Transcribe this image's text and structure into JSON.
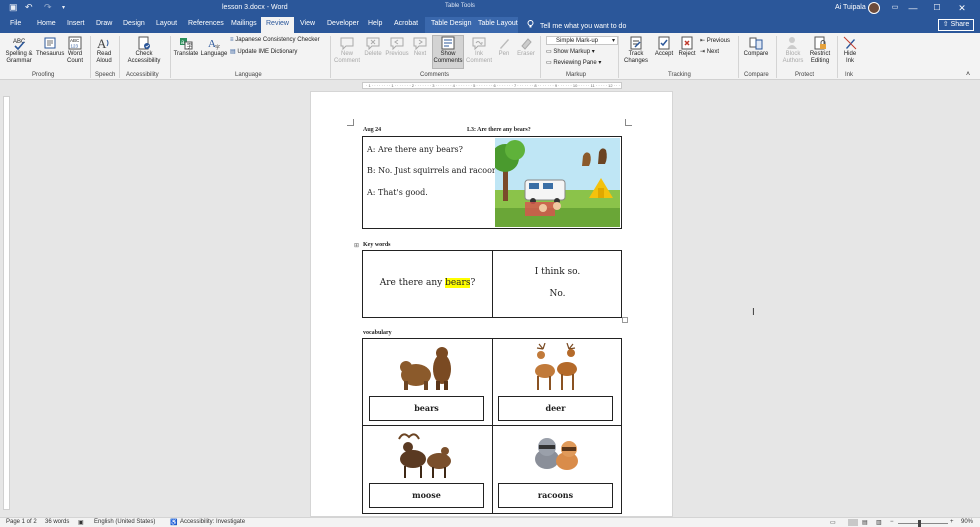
{
  "titlebar": {
    "title": "lesson 3.docx  -  Word",
    "table_tools": "Table Tools",
    "user": "Ai Tuipala",
    "undo_glyph": "↶",
    "redo_glyph": "↷",
    "save_glyph": "▣",
    "minimize": "—",
    "restore": "▭",
    "maximize": "☐",
    "close": "✕"
  },
  "tabs": [
    "File",
    "Home",
    "Insert",
    "Draw",
    "Design",
    "Layout",
    "References",
    "Mailings",
    "Review",
    "View",
    "Developer",
    "Help",
    "Acrobat",
    "Table Design",
    "Table Layout"
  ],
  "tell_me": "Tell me what you want to do",
  "share": "Share",
  "ribbon": {
    "spelling": "Spelling &\nGrammar",
    "thesaurus": "Thesaurus",
    "word_count": "Word\nCount",
    "read_aloud": "Read\nAloud",
    "check_access": "Check\nAccessibility",
    "translate": "Translate",
    "language": "Language",
    "jp_checker": "Japanese Consistency Checker",
    "ime_dict": "Update IME Dictionary",
    "new_comment": "New\nComment",
    "delete": "Delete",
    "previous": "Previous",
    "next": "Next",
    "show_comments": "Show\nComments",
    "ink_comment": "Ink\nComment",
    "pen": "Pen",
    "eraser": "Eraser",
    "markup_mode": "Simple Mark-up",
    "show_markup": "Show Markup",
    "reviewing_pane": "Reviewing Pane",
    "track_changes": "Track\nChanges",
    "accept": "Accept",
    "reject": "Reject",
    "prev_change": "Previous",
    "next_change": "Next",
    "compare": "Compare",
    "block_authors": "Block\nAuthors",
    "restrict": "Restrict\nEditing",
    "hide_ink": "Hide\nInk",
    "groups": {
      "proofing": "Proofing",
      "speech": "Speech",
      "accessibility": "Accessibility",
      "language": "Language",
      "comments": "Comments",
      "markup": "Markup",
      "tracking": "Tracking",
      "compare": "Compare",
      "protect": "Protect",
      "ink": "Ink"
    }
  },
  "ruler": "· 1 · · · · · · · · 1 · · · · · · · 2 · · · · · · · 3 · · · · · · · 4 · · · · · · · 5 · · · · · · · 6 · · · · · · · 7 · · · · · · · 8 · · · · · · · 9 · · · · · · 10 · · · · · 11 · · · · · 12 · · · · · 13 · · · · · 14 · · · · · 15 · · · · 16 · · · · 17 · · · · 18",
  "document": {
    "date": "Aug 24",
    "lesson": "L3: Are there any bears?",
    "dialogue": [
      "A: Are there any bears?",
      "B: No. Just squirrels and racoons.",
      "A: That's good."
    ],
    "key_words_heading": "Key words",
    "question_before": "Are there any ",
    "question_highlight": "bears",
    "question_after": "?",
    "answer1": "I think so.",
    "answer2": "No.",
    "vocab_heading": "vocabulary",
    "vocab": [
      "bears",
      "deer",
      "moose",
      "racoons"
    ]
  },
  "statusbar": {
    "page": "Page 1 of 2",
    "words": "36 words",
    "language": "English (United States)",
    "accessibility": "Accessibility: Investigate",
    "zoom": "90%"
  },
  "colors": {
    "accent": "#2b579a",
    "highlight": "#ffff00"
  }
}
